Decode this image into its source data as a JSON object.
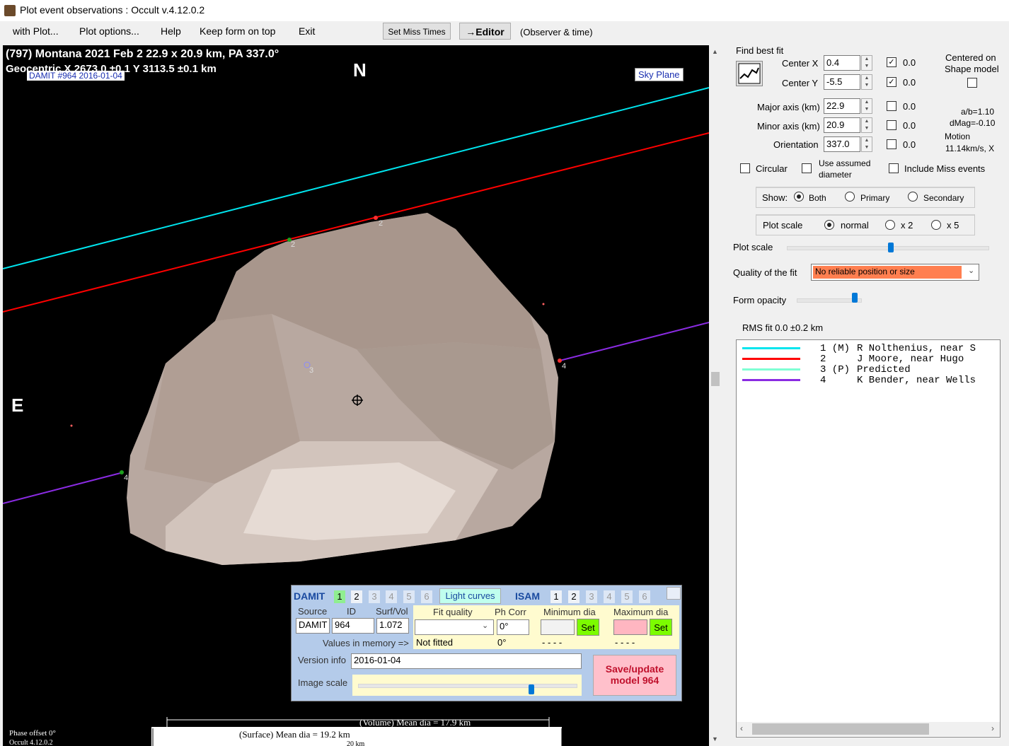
{
  "window": {
    "title": "Plot event observations : Occult v.4.12.0.2"
  },
  "menu": {
    "with_plot": "with Plot...",
    "plot_options": "Plot options...",
    "help": "Help",
    "keep_on_top": "Keep form on top",
    "exit": "Exit",
    "set_miss_times": "Set Miss Times",
    "editor": "→Editor",
    "observer_time": "(Observer & time)"
  },
  "plot": {
    "header_line1": "(797) Montana  2021 Feb 2   22.9 x 20.9 km, PA 337.0°",
    "header_line2": "Geocentric X   2673.0 ±0.1  Y 3113.5 ±0.1 km",
    "damit_label": "DAMIT #964 2016-01-04",
    "north": "N",
    "east": "E",
    "sky_plane": "Sky Plane",
    "chord_labels": [
      "2",
      "2",
      "3",
      "4",
      "4"
    ],
    "volume_dia": "(Volume) Mean dia = 17.9 km",
    "surface_dia": "(Surface) Mean dia = 19.2 km",
    "scale_20": "20 km",
    "phase_offset": "Phase offset 0°",
    "occult_version": "Occult 4.12.0.2"
  },
  "fit": {
    "find_best_fit": "Find best fit",
    "center_x_label": "Center X",
    "center_x": "0.4",
    "center_y_label": "Center Y",
    "center_y": "-5.5",
    "major_label": "Major axis (km)",
    "major": "22.9",
    "minor_label": "Minor axis (km)",
    "minor": "20.9",
    "orientation_label": "Orientation",
    "orientation": "337.0",
    "check_values": [
      "0.0",
      "0.0",
      "0.0",
      "0.0",
      "0.0"
    ],
    "centered_on": "Centered on",
    "shape_model": "Shape model",
    "ab_ratio": "a/b=1.10",
    "dmag": "dMag=-0.10",
    "motion": "Motion",
    "motion_val": "11.14km/s, X",
    "circular": "Circular",
    "use_assumed": "Use assumed",
    "diameter": "diameter",
    "include_miss": "Include Miss events"
  },
  "show": {
    "label": "Show:",
    "both": "Both",
    "primary": "Primary",
    "secondary": "Secondary"
  },
  "plot_scale": {
    "label": "Plot scale",
    "normal": "normal",
    "x2": "x 2",
    "x5": "x 5",
    "slider_label": "Plot scale",
    "slider_value": 0.52
  },
  "quality": {
    "label": "Quality of the fit",
    "value": "No reliable position or size",
    "color": "#ff7f50"
  },
  "form_opacity": {
    "label": "Form opacity",
    "value": 0.95
  },
  "rms": "RMS fit 0.0 ±0.2 km",
  "legend": [
    {
      "num": "1 (M)",
      "name": "R Nolthenius, near S",
      "color": "#00e5ee"
    },
    {
      "num": "2",
      "name": "J Moore, near Hugo",
      "color": "#ff0000"
    },
    {
      "num": "3 (P)",
      "name": "Predicted",
      "color": "#7fffd4"
    },
    {
      "num": "4",
      "name": "K Bender, near Wells",
      "color": "#8a2be2"
    }
  ],
  "damit_panel": {
    "damit": "DAMIT",
    "damit_tabs": [
      "1",
      "2",
      "3",
      "4",
      "5",
      "6"
    ],
    "light_curves": "Light curves",
    "isam": "ISAM",
    "isam_tabs": [
      "1",
      "2",
      "3",
      "4",
      "5",
      "6"
    ],
    "source_label": "Source",
    "id_label": "ID",
    "surfvol_label": "Surf/Vol",
    "source": "DAMIT",
    "id": "964",
    "surfvol": "1.072",
    "fit_quality_label": "Fit quality",
    "ph_corr_label": "Ph Corr",
    "ph_corr": "0°",
    "min_dia_label": "Minimum dia",
    "max_dia_label": "Maximum dia",
    "set": "Set",
    "values_in_memory": "Values in memory =>",
    "not_fitted": "Not fitted",
    "ph_mem": "0°",
    "dashes": "- - - -",
    "version_label": "Version info",
    "version": "2016-01-04",
    "image_scale_label": "Image scale",
    "image_scale_value": 0.82,
    "save_button": "Save/update model 964"
  }
}
